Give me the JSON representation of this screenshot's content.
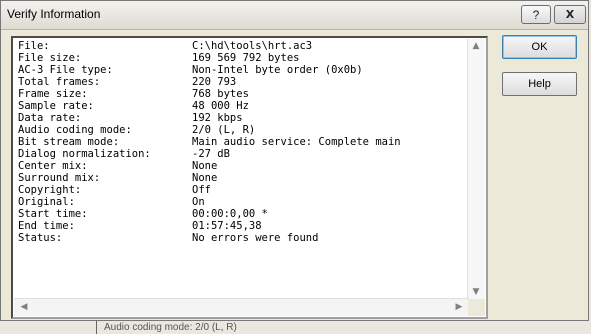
{
  "window": {
    "title": "Verify Information"
  },
  "titlebar_buttons": {
    "help_glyph": "?",
    "close_glyph": "X"
  },
  "buttons": {
    "ok": "OK",
    "help": "Help"
  },
  "info": [
    {
      "label": "File:",
      "value": "C:\\hd\\tools\\hrt.ac3"
    },
    {
      "label": "File size:",
      "value": "169 569 792 bytes"
    },
    {
      "label": "AC-3 File type:",
      "value": "Non-Intel byte order (0x0b)"
    },
    {
      "label": "Total frames:",
      "value": "220 793"
    },
    {
      "label": "Frame size:",
      "value": "768 bytes"
    },
    {
      "label": "Sample rate:",
      "value": "48 000 Hz"
    },
    {
      "label": "Data rate:",
      "value": "192 kbps"
    },
    {
      "label": "Audio coding mode:",
      "value": "2/0 (L, R)"
    },
    {
      "label": "Bit stream mode:",
      "value": "Main audio service: Complete main"
    },
    {
      "label": "Dialog normalization:",
      "value": "-27 dB"
    },
    {
      "label": "Center mix:",
      "value": "None"
    },
    {
      "label": "Surround mix:",
      "value": "None"
    },
    {
      "label": "Copyright:",
      "value": "Off"
    },
    {
      "label": "Original:",
      "value": "On"
    },
    {
      "label": "Start time:",
      "value": "00:00:0,00 *"
    },
    {
      "label": "End time:",
      "value": "01:57:45,38"
    },
    {
      "label": "Status:",
      "value": "No errors were found"
    }
  ],
  "background": {
    "partial_text": "Audio coding mode:    2/0 (L, R)"
  }
}
